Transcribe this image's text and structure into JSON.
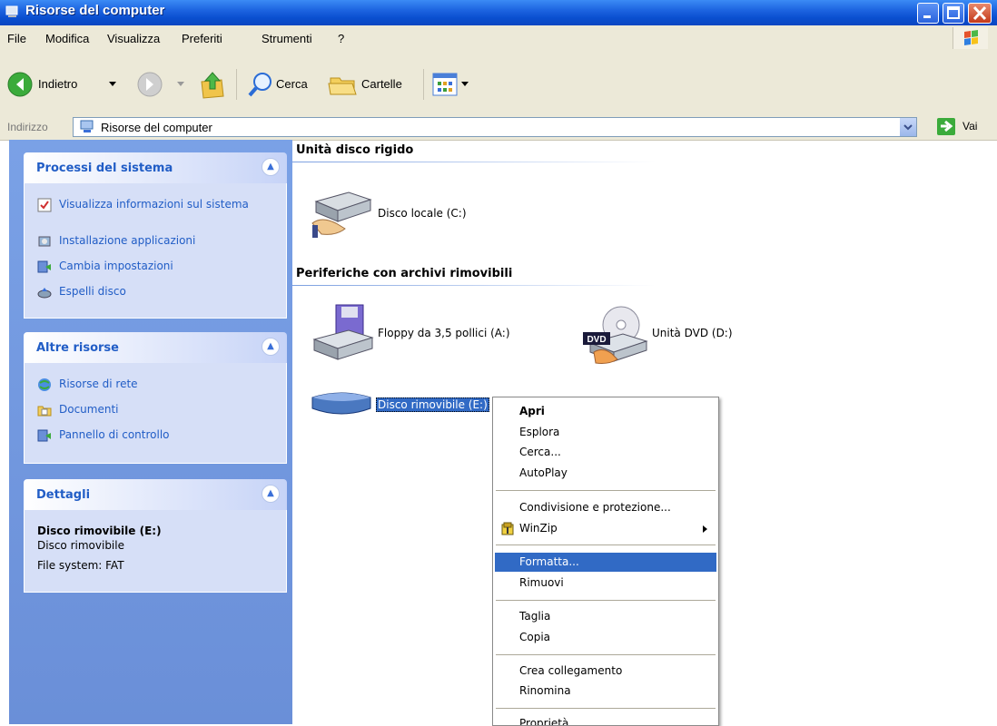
{
  "window": {
    "title": "Risorse del computer"
  },
  "menubar": {
    "items": [
      "File",
      "Modifica",
      "Visualizza",
      "Preferiti",
      "Strumenti",
      "?"
    ]
  },
  "toolbar": {
    "back_label": "Indietro",
    "search_label": "Cerca",
    "folders_label": "Cartelle"
  },
  "address": {
    "label": "Indirizzo",
    "value": "Risorse del computer",
    "go_label": "Vai"
  },
  "sidebar": {
    "system_tasks": {
      "title": "Processi del sistema",
      "items": [
        "Visualizza informazioni sul sistema",
        "Installazione applicazioni",
        "Cambia impostazioni",
        "Espelli disco"
      ]
    },
    "other_places": {
      "title": "Altre risorse",
      "items": [
        "Risorse di rete",
        "Documenti",
        "Pannello di controllo"
      ]
    },
    "details": {
      "title": "Dettagli",
      "name": "Disco rimovibile (E:)",
      "type": "Disco rimovibile",
      "fs": "File system: FAT"
    }
  },
  "content": {
    "hdd_group": "Unità disco rigido",
    "local_disk": "Disco locale (C:)",
    "removable_group": "Periferiche con archivi rimovibili",
    "floppy": "Floppy da 3,5 pollici (A:)",
    "dvd": "Unità DVD (D:)",
    "dvd_badge": "DVD",
    "removable": "Disco rimovibile (E:)"
  },
  "context_menu": {
    "open": "Apri",
    "explore": "Esplora",
    "search": "Cerca...",
    "autoplay": "AutoPlay",
    "sharing": "Condivisione e protezione...",
    "winzip": "WinZip",
    "format": "Formatta...",
    "remove": "Rimuovi",
    "cut": "Taglia",
    "copy": "Copia",
    "shortcut": "Crea collegamento",
    "rename": "Rinomina",
    "properties": "Proprietà"
  },
  "colors": {
    "selection": "#316ac5",
    "titlebar": "#0a4fd0",
    "sidebar": "#6a8fd8",
    "link": "#215dc6"
  }
}
